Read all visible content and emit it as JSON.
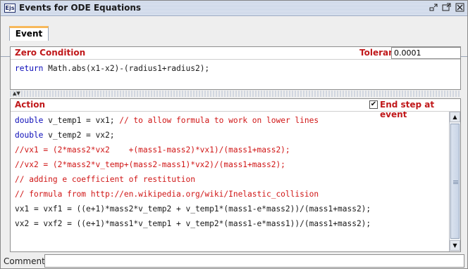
{
  "window": {
    "app_icon_text": "Ejs",
    "title": "Events for ODE Equations",
    "buttons": [
      "minimize-icon",
      "maximize-icon",
      "close-icon"
    ]
  },
  "tabs": [
    {
      "label": "Event",
      "selected": true
    }
  ],
  "zero_condition": {
    "label": "Zero Condition",
    "tolerance_label": "Tolerance",
    "tolerance_value": "0.0001",
    "code_keyword": "return",
    "code_rest": " Math.abs(x1-x2)-(radius1+radius2);"
  },
  "action": {
    "label": "Action",
    "end_step_label": "End step at event",
    "end_step_checked": true,
    "line1_kw": "double",
    "line1_plain": " v_temp1 = vx1; ",
    "line1_comment": "// to allow formula to work on lower lines",
    "line2_kw": "double",
    "line2_plain": " v_temp2 = vx2;",
    "line3": "//vx1 = (2*mass2*vx2    +(mass1-mass2)*vx1)/(mass1+mass2);",
    "line4": "//vx2 = (2*mass2*v_temp+(mass2-mass1)*vx2)/(mass1+mass2);",
    "line5": "// adding e coefficient of restitution",
    "line6": "// formula from http://en.wikipedia.org/wiki/Inelastic_collision",
    "line7": "vx1 = vxf1 = ((e+1)*mass2*v_temp2 + v_temp1*(mass1-e*mass2))/(mass1+mass2);",
    "line8": "vx2 = vxf2 = ((e+1)*mass1*v_temp1 + v_temp2*(mass1-e*mass1))/(mass1+mass2);"
  },
  "comment": {
    "label": "Comment",
    "value": ""
  },
  "colors": {
    "label_red": "#c0181a",
    "keyword_blue": "#0a0ab8",
    "comment_red": "#d01616",
    "tab_accent": "#f7b85a"
  }
}
